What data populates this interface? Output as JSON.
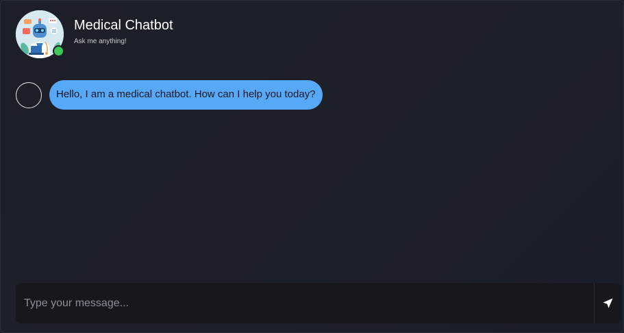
{
  "header": {
    "title": "Medical Chatbot",
    "subtitle": "Ask me anything!",
    "avatar_icon": "doctor-robot-illustration",
    "status": "online",
    "status_color": "#3cc85a"
  },
  "messages": [
    {
      "sender": "bot",
      "text": "Hello, I am a medical chatbot. How can I help you today?",
      "bubble_color": "#58a8f8"
    }
  ],
  "composer": {
    "placeholder": "Type your message...",
    "value": "",
    "send_icon": "send-arrow-icon"
  },
  "colors": {
    "background": "#1c1f27",
    "input_background": "#16181d",
    "accent": "#58a8f8"
  }
}
